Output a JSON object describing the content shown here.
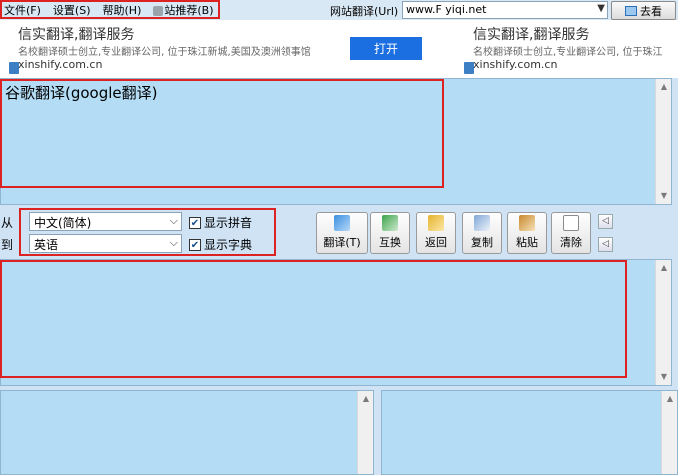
{
  "menu": {
    "items": [
      {
        "label": "文件(F)"
      },
      {
        "label": "设置(S)"
      },
      {
        "label": "帮助(H)"
      },
      {
        "label": "站推荐(B)"
      }
    ]
  },
  "url_bar": {
    "label": "网站翻译(Url)",
    "value": "www.F     yiqi.net",
    "go_label": "去看"
  },
  "ads": [
    {
      "title": "信实翻译,翻译服务",
      "desc": "名校翻译硕士创立,专业翻译公司, 位于珠江新城,美国及澳洲领事馆",
      "domain": "xinshify.com.cn",
      "button": "打开"
    },
    {
      "title": "信实翻译,翻译服务",
      "desc": "名校翻译硕士创立,专业翻译公司, 位于珠江",
      "domain": "xinshify.com.cn"
    }
  ],
  "source": {
    "text": "谷歌翻译(google翻译)"
  },
  "lang": {
    "from_label": "从",
    "to_label": "到",
    "from_value": "中文(简体)",
    "to_value": "英语",
    "show_pinyin": "显示拼音",
    "show_dict": "显示字典"
  },
  "toolbar": {
    "translate": "翻译(T)",
    "swap": "互换",
    "back": "返回",
    "copy": "复制",
    "paste": "粘贴",
    "clear": "清除"
  },
  "colors": {
    "highlight": "#dd2222",
    "text_area_bg": "#b4dcf5",
    "ad_button": "#1c6fe0"
  }
}
